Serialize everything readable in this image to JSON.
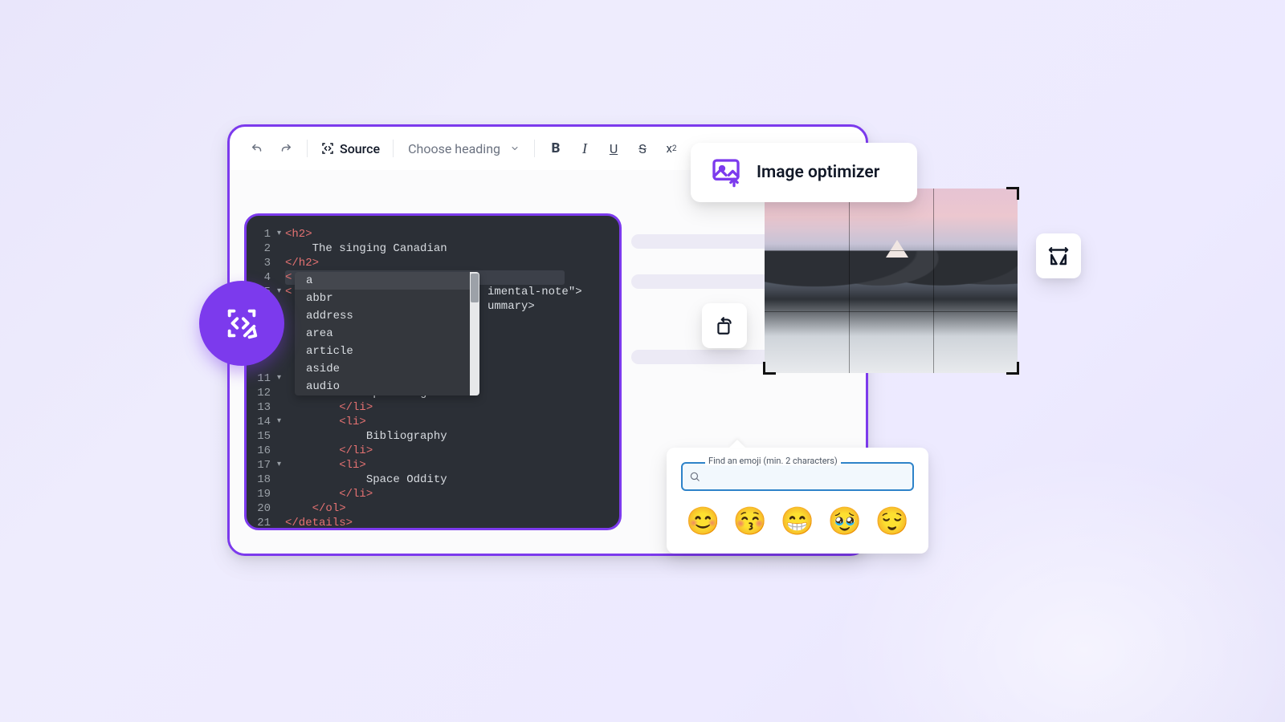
{
  "toolbar": {
    "source_label": "Source",
    "heading_label": "Choose heading"
  },
  "code": {
    "lines": [
      {
        "n": 1,
        "fold": "▾",
        "raw": "<h2>"
      },
      {
        "n": 2,
        "fold": "",
        "raw": "    The singing Canadian"
      },
      {
        "n": 3,
        "fold": "",
        "raw": "</h2>"
      },
      {
        "n": 4,
        "fold": "",
        "raw": "<"
      },
      {
        "n": 5,
        "fold": "▾",
        "raw": "<"
      },
      {
        "n": 11,
        "fold": "▾",
        "raw": ""
      },
      {
        "n": 12,
        "fold": "",
        "raw": "            Spaceflights"
      },
      {
        "n": 13,
        "fold": "",
        "raw": "        </li>"
      },
      {
        "n": 14,
        "fold": "▾",
        "raw": "        <li>"
      },
      {
        "n": 15,
        "fold": "",
        "raw": "            Bibliography"
      },
      {
        "n": 16,
        "fold": "",
        "raw": "        </li>"
      },
      {
        "n": 17,
        "fold": "▾",
        "raw": "        <li>"
      },
      {
        "n": 18,
        "fold": "",
        "raw": "            Space Oddity"
      },
      {
        "n": 19,
        "fold": "",
        "raw": "        </li>"
      },
      {
        "n": 20,
        "fold": "",
        "raw": "    </ol>"
      },
      {
        "n": 21,
        "fold": "",
        "raw": "</details>"
      }
    ],
    "ghost_right_1": "imental-note\">",
    "ghost_right_2": "ummary>",
    "autocomplete": [
      "a",
      "abbr",
      "address",
      "area",
      "article",
      "aside",
      "audio"
    ]
  },
  "optimizer": {
    "title": "Image optimizer"
  },
  "emoji": {
    "legend": "Find an emoji (min. 2 characters)",
    "list": [
      "😊",
      "😚",
      "😁",
      "🥹",
      "😌"
    ]
  },
  "icon_names": {
    "undo": "undo-icon",
    "redo": "redo-icon",
    "source": "source-code-icon",
    "caret": "chevron-down-icon",
    "bold": "bold-icon",
    "italic": "italic-icon",
    "underline": "underline-icon",
    "strike": "strikethrough-icon",
    "subscript": "subscript-icon",
    "fab": "source-edit-icon",
    "optimizer": "image-upload-icon",
    "rotate": "rotate-left-icon",
    "flip": "flip-horizontal-icon",
    "search": "search-icon"
  }
}
